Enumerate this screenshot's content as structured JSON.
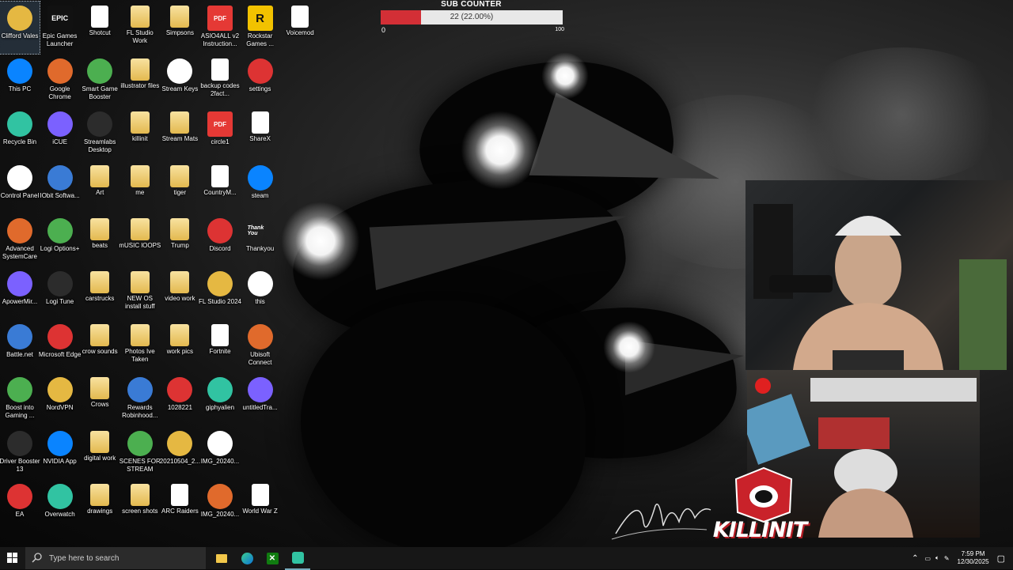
{
  "sub_counter": {
    "title": "SUB COUNTER",
    "text": "22 (22.00%)",
    "min": "0",
    "max": "100",
    "progress": 0.22
  },
  "desktop_icons": [
    [
      "Clifford Vales",
      "Epic Games Launcher",
      "Shotcut",
      "FL Studio Work",
      "Simpsons",
      "ASIO4ALL v2 Instruction...",
      "Rockstar Games ...",
      "Voicemod"
    ],
    [
      "This PC",
      "Google Chrome",
      "Smart Game Booster",
      "illustrator files",
      "Stream Keys",
      "backup codes 2fact...",
      "settings"
    ],
    [
      "Recycle Bin",
      "iCUE",
      "Streamlabs Desktop",
      "killinit",
      "Stream Mats",
      "circle1",
      "ShareX"
    ],
    [
      "Control Panel",
      "IObit Softwa...",
      "Art",
      "me",
      "tiger",
      "CountryM...",
      "steam"
    ],
    [
      "Advanced SystemCare",
      "Logi Options+",
      "beats",
      "mUSIC lOOPS",
      "Trump",
      "Discord",
      "Thankyou"
    ],
    [
      "ApowerMir...",
      "Logi Tune",
      "carstrucks",
      "NEW OS install stuff",
      "video work",
      "FL Studio 2024",
      "this"
    ],
    [
      "Battle.net",
      "Microsoft Edge",
      "crow sounds",
      "Photos Ive Taken",
      "work pics",
      "Fortnite",
      "Ubisoft Connect"
    ],
    [
      "Boost into Gaming ...",
      "NordVPN",
      "Crows",
      "Rewards Robinhood...",
      "1028221",
      "giphyalien",
      "untitledTra..."
    ],
    [
      "Driver Booster 13",
      "NVIDIA App",
      "digital work",
      "SCENES FOR STREAM",
      "20210504_2...",
      "IMG_20240..."
    ],
    [
      "EA",
      "Overwatch",
      "drawings",
      "screen shots",
      "ARC Raiders",
      "IMG_20240...",
      "World War Z"
    ]
  ],
  "icon_badges": {
    "epic": "EPIC",
    "pdf": "PDF",
    "rockstar": "R",
    "thankyou": "Thank You"
  },
  "overlay": {
    "logo_text": "KILLINIT"
  },
  "taskbar": {
    "search_placeholder": "Type here to search",
    "time": "7:59 PM",
    "date": "12/30/2025"
  },
  "colors": {
    "counter_fill": "#d32f36",
    "taskbar": "#171717"
  }
}
